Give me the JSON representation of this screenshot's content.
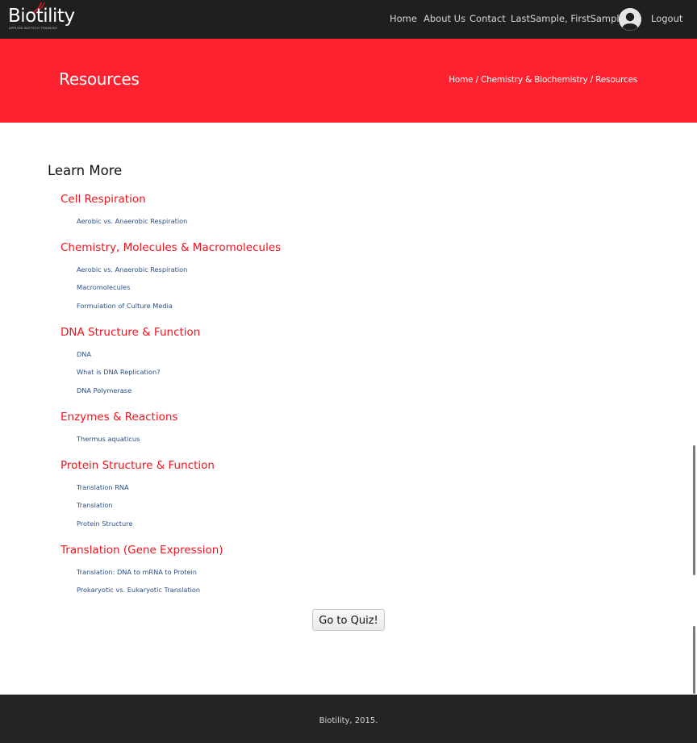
{
  "navbar": {
    "logo_text": "Biotility",
    "logo_tagline": "APPLIED BIOTECH TRAINING",
    "links": {
      "home": "Home",
      "about": "About Us",
      "contact": "Contact",
      "user": "LastSample, FirstSample",
      "logout": "Logout"
    },
    "avatar_icon": "user-avatar-icon"
  },
  "banner": {
    "title": "Resources",
    "breadcrumb": {
      "home": "Home",
      "sep1": " / ",
      "category": "Chemistry & Biochemistry",
      "sep2": " / ",
      "current": "Resources"
    },
    "color": "#fe2230"
  },
  "main": {
    "heading": "Learn More",
    "topics": [
      {
        "title": "Cell Respiration",
        "links": [
          "Aerobic vs. Anaerobic Respiration"
        ]
      },
      {
        "title": "Chemistry, Molecules & Macromolecules",
        "links": [
          "Aerobic vs. Anaerobic Respiration",
          "Macromolecules",
          "Formulation of Culture Media"
        ]
      },
      {
        "title": "DNA Structure & Function",
        "links": [
          "DNA",
          "What is DNA Replication?",
          "DNA Polymerase"
        ]
      },
      {
        "title": "Enzymes & Reactions",
        "links": [
          "Thermus aquaticus"
        ]
      },
      {
        "title": "Protein Structure & Function",
        "links": [
          "Translation RNA",
          "Translation",
          "Protein Structure"
        ]
      },
      {
        "title": "Translation (Gene Expression)",
        "links": [
          "Translation: DNA to mRNA to Protein",
          "Prokaryotic vs. Eukaryotic Translation"
        ]
      }
    ],
    "quiz_button": "Go to Quiz!",
    "topic_color": "#f0141e",
    "link_color": "#2b4f86"
  },
  "footer": {
    "text": "Biotility, 2015."
  }
}
